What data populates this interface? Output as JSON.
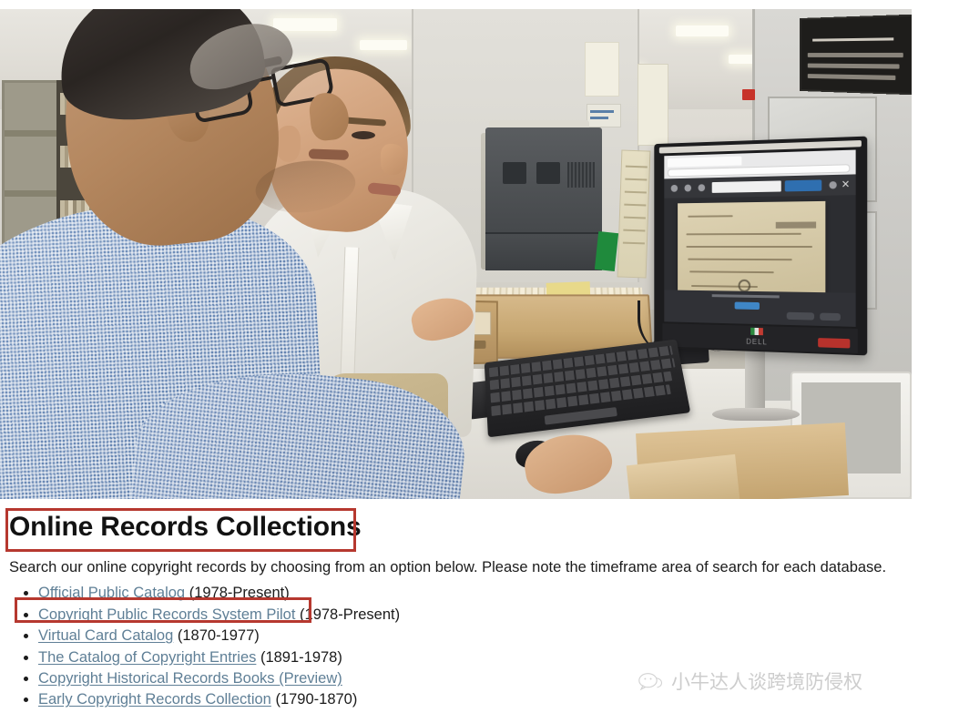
{
  "page": {
    "title": "Online Records Collections",
    "lede": "Search our online copyright records by choosing from an option below. Please note the timeframe area of search for each database."
  },
  "records": [
    {
      "link": "Official Public Catalog",
      "years": " (1978-Present)"
    },
    {
      "link": "Copyright Public Records System Pilot",
      "years": " (1978-Present)"
    },
    {
      "link": "Virtual Card Catalog",
      "years": " (1870-1977)"
    },
    {
      "link": "The Catalog of Copyright Entries",
      "years": " (1891-1978)"
    },
    {
      "link": "Copyright Historical Records Books (Preview)",
      "years": ""
    },
    {
      "link": "Early Copyright Records Collection",
      "years": " (1790-1870)"
    }
  ],
  "photo": {
    "alt": "Two men seated at a library desk using a computer with a wooden card catalog tray",
    "monitor_brand": "DELL",
    "wall_sign_text": "SEARCH LIBRARY OF CONGRESS FILES IN COMPUTER CATALOG CENTERS IN JEFFERSON OR ADAMS BUILDINGS",
    "recycle_symbol": "♻"
  },
  "watermark": {
    "text": "小牛达人谈跨境防侵权",
    "icon": "wechat-bubble-icon"
  },
  "annotations": {
    "title_box": "red-highlight-rectangle",
    "first_item_box": "red-highlight-rectangle"
  },
  "colors": {
    "annotation_red": "#b6382f",
    "link_blue": "#5f7f96",
    "text_dark": "#1b1b1b",
    "watermark_gray": "#c9c9c9"
  }
}
